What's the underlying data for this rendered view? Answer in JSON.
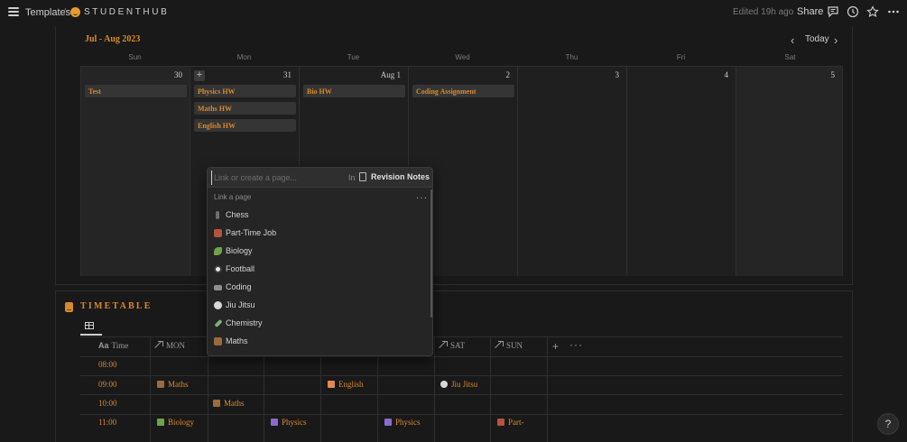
{
  "breadcrumb": {
    "root": "Templates",
    "separator": "/",
    "page": "STUDENTHUB"
  },
  "header": {
    "edited": "Edited 19h ago",
    "share": "Share"
  },
  "calendar": {
    "month": "Jul - Aug 2023",
    "today": "Today",
    "days_of_week": [
      "Sun",
      "Mon",
      "Tue",
      "Wed",
      "Thu",
      "Fri",
      "Sat"
    ],
    "days": [
      {
        "num": "30",
        "events": [
          "Test"
        ]
      },
      {
        "num": "31",
        "events": [
          "Physics HW",
          "Maths HW",
          "English HW"
        ]
      },
      {
        "num": "Aug 1",
        "events": [
          "Bio HW"
        ]
      },
      {
        "num": "2",
        "events": [
          "Coding Assignment"
        ]
      },
      {
        "num": "3",
        "events": []
      },
      {
        "num": "4",
        "events": []
      },
      {
        "num": "5",
        "events": []
      }
    ]
  },
  "link_popup": {
    "placeholder": "Link or create a page...",
    "in_label": "In",
    "target_page": "Revision Notes",
    "section_label": "Link a page",
    "pages": [
      {
        "label": "Chess",
        "icon": "chess-icon",
        "color": "#6e6e6e"
      },
      {
        "label": "Part-Time Job",
        "icon": "briefcase-icon",
        "color": "#b5533c"
      },
      {
        "label": "Biology",
        "icon": "leaf-icon",
        "color": "#6fa34a"
      },
      {
        "label": "Football",
        "icon": "soccer-ball-icon",
        "color": "#e6e6e6"
      },
      {
        "label": "Coding",
        "icon": "keyboard-icon",
        "color": "#8f8f8f"
      },
      {
        "label": "Jiu Jitsu",
        "icon": "gi-icon",
        "color": "#d8d8d8"
      },
      {
        "label": "Chemistry",
        "icon": "test-tube-icon",
        "color": "#7fb07a"
      },
      {
        "label": "Maths",
        "icon": "abacus-icon",
        "color": "#9b6b3c"
      }
    ]
  },
  "timetable": {
    "title": "TIMETABLE",
    "columns": {
      "time": "Time",
      "time_prefix": "Aa",
      "mon": "MON",
      "sat": "SAT",
      "sun": "SUN"
    },
    "times": [
      "08:00",
      "09:00",
      "10:00",
      "11:00"
    ],
    "cells": {
      "r0_mon": "Maths",
      "r0_thu": "English",
      "r0_sat": "Jiu Jitsu",
      "r1_tue": "Maths",
      "r2_mon": "Biology",
      "r2_wed": "Physics",
      "r2_fri": "Physics",
      "r2_sun": "Part-"
    }
  },
  "help": "?"
}
